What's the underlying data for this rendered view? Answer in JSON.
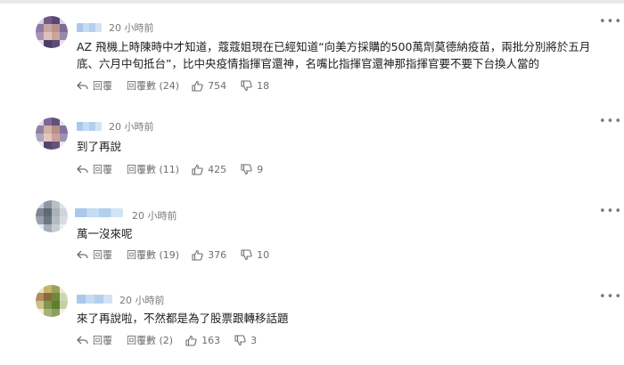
{
  "comments": [
    {
      "time": "20 小時前",
      "text": "AZ 飛機上時陳時中才知道，蔻蔻姐現在已經知道“向美方採購的500萬劑莫德納疫苗，兩批分別將於五月底、六月中旬抵台”，比中央疫情指揮官還神，名嘴比指揮官還神那指揮官要不要下台換人當的",
      "reply_label": "回覆",
      "replies_label": "回覆數 (24)",
      "likes": "754",
      "dislikes": "18"
    },
    {
      "time": "20 小時前",
      "text": "到了再說",
      "reply_label": "回覆",
      "replies_label": "回覆數 (11)",
      "likes": "425",
      "dislikes": "9"
    },
    {
      "time": "20 小時前",
      "text": "萬一沒來呢",
      "reply_label": "回覆",
      "replies_label": "回覆數 (19)",
      "likes": "376",
      "dislikes": "10"
    },
    {
      "time": "20 小時前",
      "text": "來了再說啦，不然都是為了股票跟轉移話題",
      "reply_label": "回覆",
      "replies_label": "回覆數 (2)",
      "likes": "163",
      "dislikes": "3"
    }
  ],
  "icons": {
    "more": "more-horizontal-icon",
    "reply": "reply-arrow-icon",
    "replies": "speech-bubble-icon",
    "like": "thumbs-up-icon",
    "dislike": "thumbs-down-icon"
  },
  "colors": {
    "text": "#1c1c1c",
    "muted": "#6e6e6e",
    "name_blur": "#b3cfee"
  }
}
